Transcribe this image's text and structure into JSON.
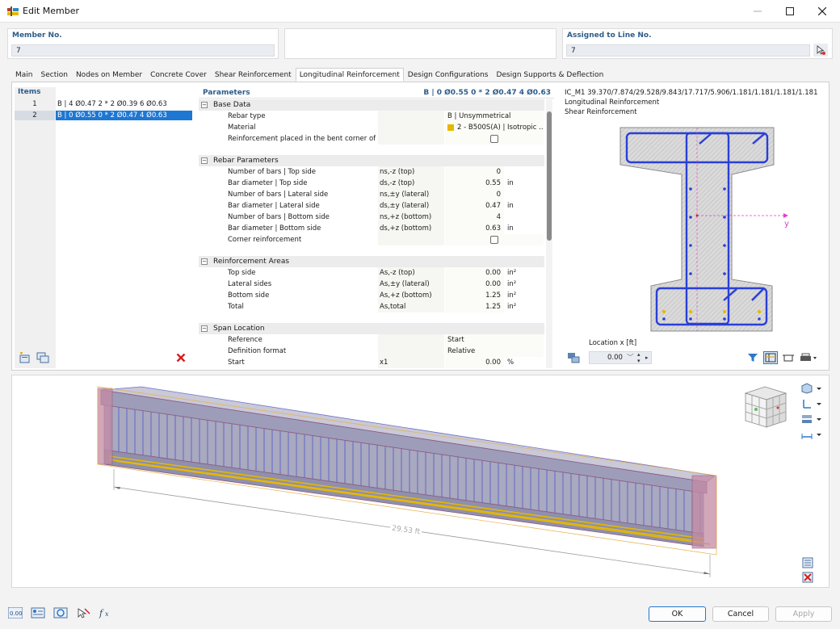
{
  "window": {
    "title": "Edit Member"
  },
  "member_no": {
    "label": "Member No.",
    "value": "7"
  },
  "assigned_line": {
    "label": "Assigned to Line No.",
    "value": "7"
  },
  "tabs": [
    {
      "label": "Main"
    },
    {
      "label": "Section"
    },
    {
      "label": "Nodes on Member"
    },
    {
      "label": "Concrete Cover"
    },
    {
      "label": "Shear Reinforcement"
    },
    {
      "label": "Longitudinal Reinforcement"
    },
    {
      "label": "Design Configurations"
    },
    {
      "label": "Design Supports & Deflection"
    }
  ],
  "items": {
    "header": "Items",
    "rows": [
      {
        "num": "1",
        "text": "B | 4 Ø0.47 2 * 2 Ø0.39 6 Ø0.63"
      },
      {
        "num": "2",
        "text": "B | 0 Ø0.55 0 * 2 Ø0.47 4 Ø0.63"
      }
    ]
  },
  "parameters": {
    "header": "Parameters",
    "summary": "B | 0 Ø0.55 0 * 2 Ø0.47 4 Ø0.63",
    "groups": {
      "base": "Base Data",
      "rebar": "Rebar Parameters",
      "areas": "Reinforcement Areas",
      "span": "Span Location"
    },
    "base": {
      "rebar_type": {
        "label": "Rebar type",
        "value": "B | Unsymmetrical"
      },
      "material": {
        "label": "Material",
        "value": "2 - B500S(A) | Isotropic ..."
      },
      "bent": {
        "label": "Reinforcement placed in the bent corner of t..."
      }
    },
    "rebar": [
      {
        "label": "Number of bars | Top side",
        "sym": "ns,-z (top)",
        "value": "0",
        "unit": ""
      },
      {
        "label": "Bar diameter | Top side",
        "sym": "ds,-z (top)",
        "value": "0.55",
        "unit": "in"
      },
      {
        "label": "Number of bars | Lateral side",
        "sym": "ns,±y (lateral)",
        "value": "0",
        "unit": ""
      },
      {
        "label": "Bar diameter | Lateral side",
        "sym": "ds,±y (lateral)",
        "value": "0.47",
        "unit": "in"
      },
      {
        "label": "Number of bars | Bottom side",
        "sym": "ns,+z (bottom)",
        "value": "4",
        "unit": ""
      },
      {
        "label": "Bar diameter | Bottom side",
        "sym": "ds,+z (bottom)",
        "value": "0.63",
        "unit": "in"
      }
    ],
    "corner": {
      "label": "Corner reinforcement"
    },
    "areas": [
      {
        "label": "Top side",
        "sym": "As,-z (top)",
        "value": "0.00",
        "unit": "in²"
      },
      {
        "label": "Lateral sides",
        "sym": "As,±y (lateral)",
        "value": "0.00",
        "unit": "in²"
      },
      {
        "label": "Bottom side",
        "sym": "As,+z (bottom)",
        "value": "1.25",
        "unit": "in²"
      },
      {
        "label": "Total",
        "sym": "As,total",
        "value": "1.25",
        "unit": "in²"
      }
    ],
    "span": {
      "reference": {
        "label": "Reference",
        "value": "Start"
      },
      "format": {
        "label": "Definition format",
        "value": "Relative"
      },
      "start": {
        "label": "Start",
        "sym": "x1",
        "value": "0.00",
        "unit": "%"
      }
    }
  },
  "section_view": {
    "info_line": "IC_M1 39.370/7.874/29.528/9.843/17.717/5.906/1.181/1.181/1.181/1.181",
    "line2": "Longitudinal Reinforcement",
    "line3": "Shear Reinforcement",
    "axis_y": "y",
    "location_label": "Location x [ft]",
    "location_value": "0.00"
  },
  "model_view": {
    "dimension": "29.53 ft"
  },
  "buttons": {
    "ok": "OK",
    "cancel": "Cancel",
    "apply": "Apply"
  },
  "colors": {
    "accent": "#1e77d3",
    "rebar": "#2a3fd6",
    "steel_yellow": "#e5b800",
    "header_blue": "#2e5c8a"
  }
}
